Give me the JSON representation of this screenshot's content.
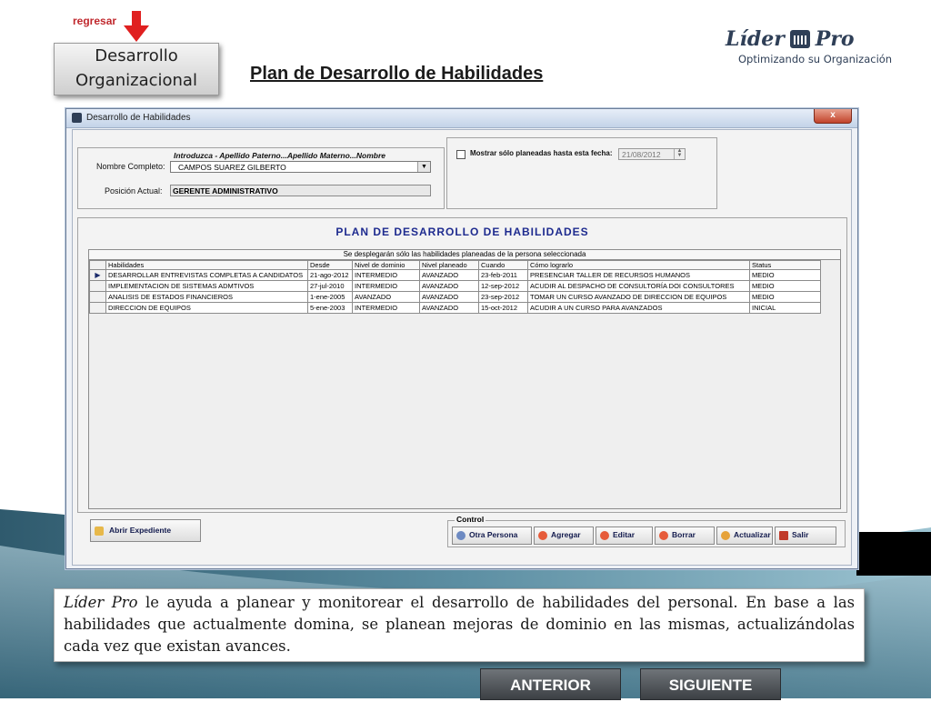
{
  "header": {
    "back_label": "regresar",
    "section_line1": "Desarrollo",
    "section_line2": "Organizacional",
    "slide_title": "Plan de Desarrollo de Habilidades",
    "logo_name_left": "Líder",
    "logo_name_right": "Pro",
    "logo_tagline": "Optimizando su Organización"
  },
  "window": {
    "title": "Desarrollo de Habilidades",
    "close_label": "x",
    "search_hint": "Introduzca - Apellido Paterno...Apellido Materno...Nombre",
    "name_label": "Nombre Completo:",
    "name_value": "CAMPOS SUAREZ GILBERTO",
    "position_label": "Posición Actual:",
    "position_value": "GERENTE ADMINISTRATIVO",
    "filter_label": "Mostrar sólo planeadas hasta esta fecha:",
    "filter_date": "21/08/2012",
    "plan_title": "PLAN DE DESARROLLO DE HABILIDADES",
    "grid_caption": "Se desplegarán sólo las habilidades planeadas de la persona seleccionada",
    "columns": [
      "Habilidades",
      "Desde",
      "Nivel de dominio",
      "Nivel planeado",
      "Cuando",
      "Cómo lograrlo",
      "Status"
    ],
    "rows": [
      [
        "DESARROLLAR ENTREVISTAS COMPLETAS A CANDIDATOS",
        "21-ago-2012",
        "INTERMEDIO",
        "AVANZADO",
        "23-feb-2011",
        "PRESENCIAR TALLER DE RECURSOS HUMANOS",
        "MEDIO"
      ],
      [
        "IMPLEMENTACION DE SISTEMAS ADMTIVOS",
        "27-jul-2010",
        "INTERMEDIO",
        "AVANZADO",
        "12-sep-2012",
        "ACUDIR AL DESPACHO DE CONSULTORÍA DOI CONSULTORES",
        "MEDIO"
      ],
      [
        "ANALISIS DE ESTADOS FINANCIEROS",
        "1-ene-2005",
        "AVANZADO",
        "AVANZADO",
        "23-sep-2012",
        "TOMAR UN CURSO AVANZADO DE DIRECCION DE EQUIPOS",
        "MEDIO"
      ],
      [
        "DIRECCION DE EQUIPOS",
        "5-ene-2003",
        "INTERMEDIO",
        "AVANZADO",
        "15-oct-2012",
        "ACUDIR A UN CURSO PARA AVANZADOS",
        "INICIAL"
      ]
    ],
    "open_file_label": "Abrir Expediente",
    "control_label": "Control",
    "buttons": {
      "other": "Otra Persona",
      "add": "Agregar",
      "edit": "Editar",
      "delete": "Borrar",
      "update": "Actualizar",
      "exit": "Salir"
    }
  },
  "description": {
    "brand": "Líder Pro",
    "text": " le ayuda a planear y monitorear el desarrollo de habilidades del personal. En base a las habilidades que actualmente domina, se planean mejoras de dominio en las mismas, actualizándolas cada vez que existan avances."
  },
  "nav": {
    "prev": "ANTERIOR",
    "next": "SIGUIENTE"
  },
  "colors": {
    "accent_red": "#c0282d",
    "logo_navy": "#2f3f57",
    "plan_title_blue": "#1e2b8f",
    "wave_teal": "#3f6f82"
  }
}
